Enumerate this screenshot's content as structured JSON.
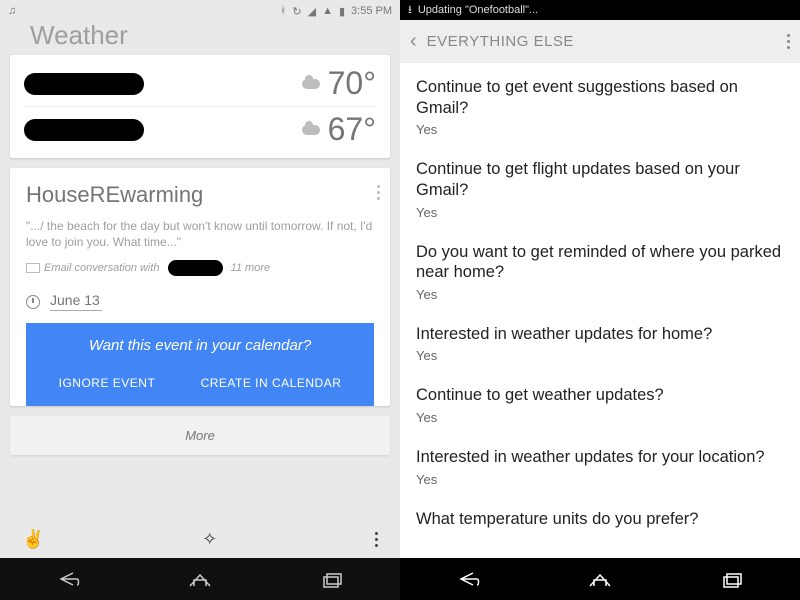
{
  "left": {
    "status": {
      "time": "3:55 PM"
    },
    "title": "Weather",
    "weather": [
      {
        "temp": "70°"
      },
      {
        "temp": "67°"
      }
    ],
    "event": {
      "title": "HouseREwarming",
      "quote": "\".../ the beach for the day but won't know until tomorrow. If not, I'd love to join you. What time...\"",
      "meta_prefix": "Email conversation with",
      "meta_suffix": "11 more",
      "date": "June 13",
      "prompt": "Want this event in your calendar?",
      "ignore": "IGNORE EVENT",
      "create": "CREATE IN CALENDAR"
    },
    "more": "More"
  },
  "right": {
    "status": {
      "text": "Updating \"Onefootball\"..."
    },
    "header": "EVERYTHING ELSE",
    "items": [
      {
        "q": "Continue to get event suggestions based on Gmail?",
        "a": "Yes"
      },
      {
        "q": "Continue to get flight updates based on your Gmail?",
        "a": "Yes"
      },
      {
        "q": "Do you want to get reminded of where you parked near home?",
        "a": "Yes"
      },
      {
        "q": "Interested in weather updates for home?",
        "a": "Yes"
      },
      {
        "q": "Continue to get weather updates?",
        "a": "Yes"
      },
      {
        "q": "Interested in weather updates for your location?",
        "a": "Yes"
      },
      {
        "q": "What temperature units do you prefer?",
        "a": ""
      }
    ]
  }
}
